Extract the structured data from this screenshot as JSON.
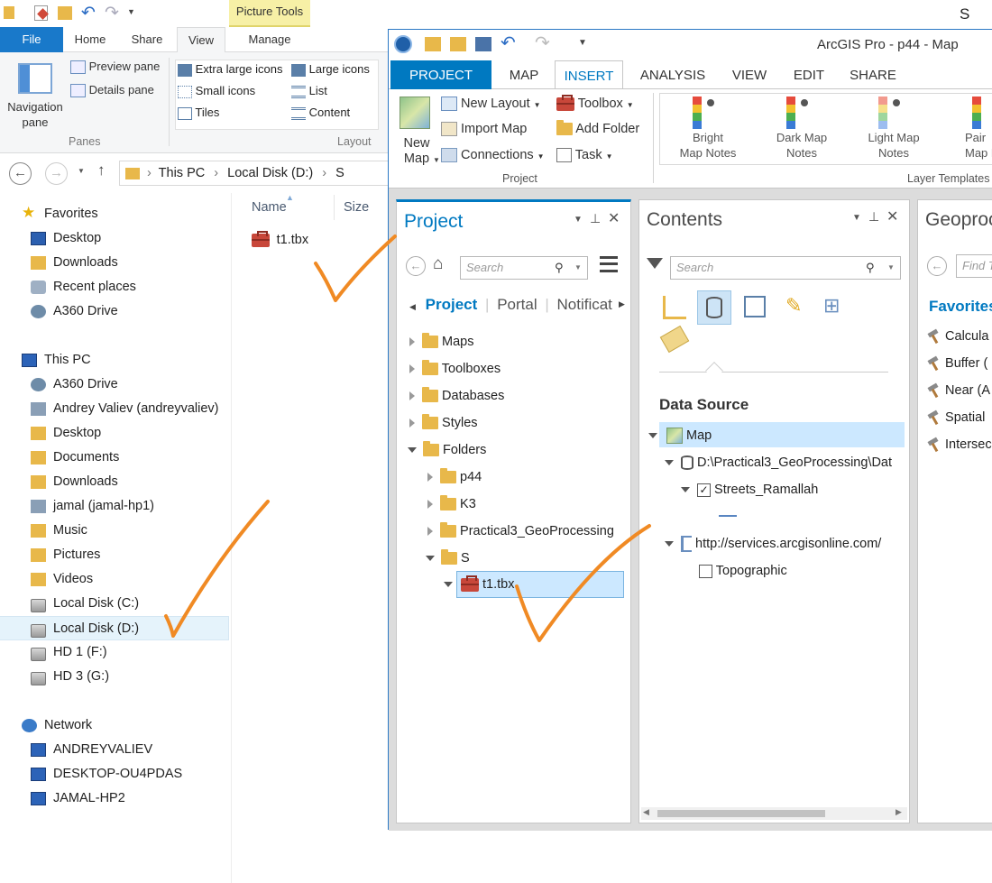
{
  "explorer": {
    "qat_right_text": "S",
    "contextual_tab": "Picture Tools",
    "tabs": {
      "file": "File",
      "home": "Home",
      "share": "Share",
      "view": "View",
      "manage": "Manage"
    },
    "ribbon": {
      "navigation_pane": "Navigation\npane",
      "preview_pane": "Preview pane",
      "details_pane": "Details pane",
      "panes_group": "Panes",
      "extra_large_icons": "Extra large icons",
      "large_icons": "Large icons",
      "small_icons": "Small icons",
      "list": "List",
      "tiles": "Tiles",
      "content": "Content",
      "layout_group": "Layout"
    },
    "breadcrumb": [
      "This PC",
      "Local Disk (D:)",
      "S"
    ],
    "columns": {
      "name": "Name",
      "size": "Size"
    },
    "files": [
      "t1.tbx"
    ],
    "nav": {
      "favorites": "Favorites",
      "favorites_items": [
        "Desktop",
        "Downloads",
        "Recent places",
        "A360 Drive"
      ],
      "this_pc": "This PC",
      "this_pc_items": [
        "A360 Drive",
        "Andrey Valiev (andreyvaliev)",
        "Desktop",
        "Documents",
        "Downloads",
        "jamal (jamal-hp1)",
        "Music",
        "Pictures",
        "Videos",
        "Local Disk (C:)",
        "Local Disk (D:)",
        "HD 1 (F:)",
        "HD 3 (G:)"
      ],
      "network": "Network",
      "network_items": [
        "ANDREYVALIEV",
        "DESKTOP-OU4PDAS",
        "JAMAL-HP2"
      ]
    }
  },
  "arcgis": {
    "title": "ArcGIS Pro - p44 - Map",
    "tabs": [
      "PROJECT",
      "MAP",
      "INSERT",
      "ANALYSIS",
      "VIEW",
      "EDIT",
      "SHARE"
    ],
    "ribbon": {
      "new_map": "New\nMap",
      "new_layout": "New Layout",
      "import_map": "Import Map",
      "connections": "Connections",
      "toolbox": "Toolbox",
      "add_folder": "Add Folder",
      "task": "Task",
      "project_group": "Project",
      "layer_templates_group": "Layer Templates",
      "templates": [
        "Bright\nMap Notes",
        "Dark Map\nNotes",
        "Light Map\nNotes",
        "Pair\nMap N"
      ]
    },
    "project_pane": {
      "title": "Project",
      "search_placeholder": "Search",
      "subtabs": [
        "Project",
        "Portal",
        "Notificat"
      ],
      "tree": {
        "maps": "Maps",
        "toolboxes": "Toolboxes",
        "databases": "Databases",
        "styles": "Styles",
        "folders": "Folders",
        "p44": "p44",
        "k3": "K3",
        "practical": "Practical3_GeoProcessing",
        "s": "S",
        "t1": "t1.tbx"
      }
    },
    "contents_pane": {
      "title": "Contents",
      "search_placeholder": "Search",
      "section": "Data Source",
      "map": "Map",
      "db_path": "D:\\Practical3_GeoProcessing\\Dat",
      "layer1": "Streets_Ramallah",
      "service": "http://services.arcgisonline.com/",
      "layer2": "Topographic"
    },
    "geoprocessing_pane": {
      "title": "Geoproc",
      "find_placeholder": "Find T",
      "favorites": "Favorites",
      "tools": [
        "Calcula",
        "Buffer (",
        "Near (A",
        "Spatial",
        "Intersec"
      ]
    }
  },
  "colors": {
    "accent": "#0079c1",
    "annotation": "#f08a24",
    "selection": "#cce8ff"
  }
}
